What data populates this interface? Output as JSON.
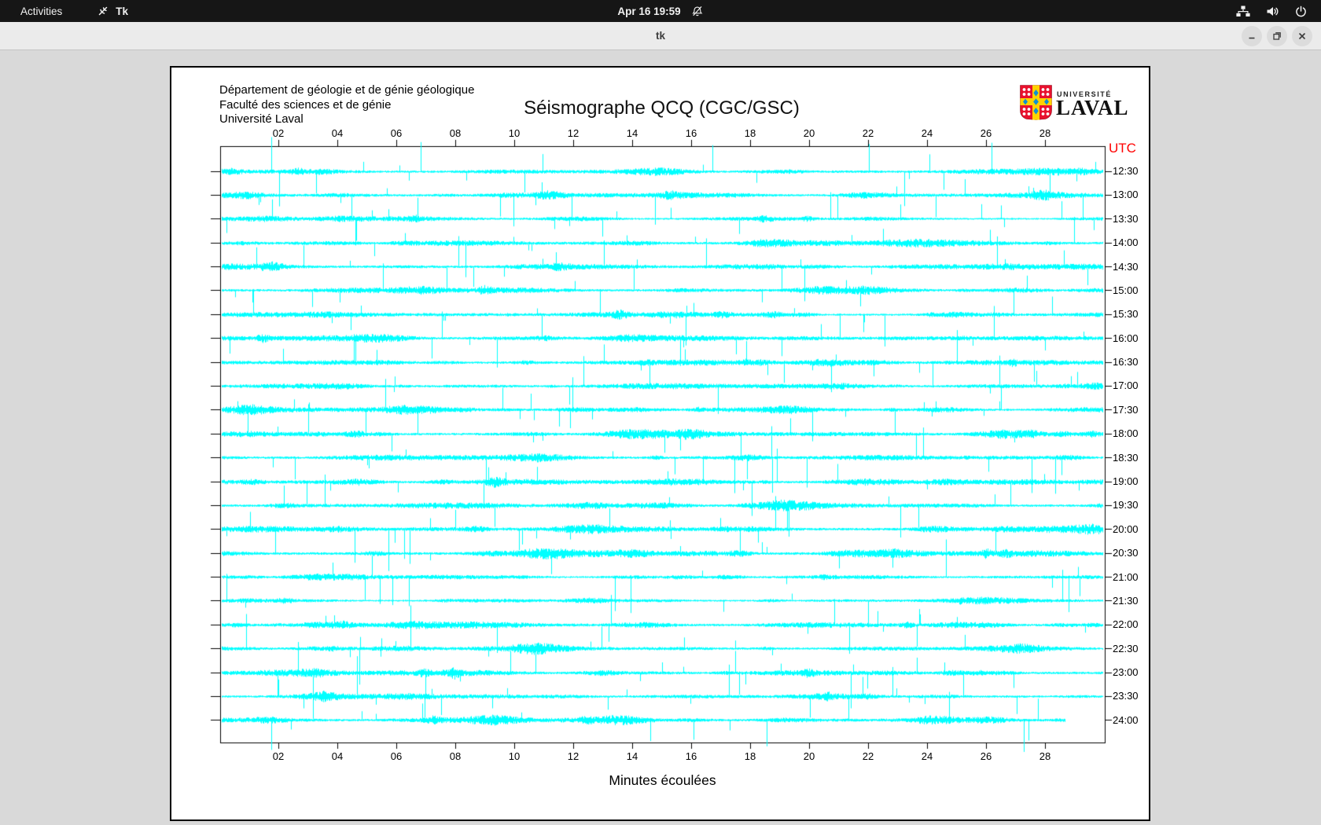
{
  "topbar": {
    "activities": "Activities",
    "app_name": "Tk",
    "clock": "Apr 16 19:59",
    "icons": [
      "tk-app-icon",
      "notifications-muted-icon",
      "network-wired-icon",
      "volume-icon",
      "power-icon"
    ]
  },
  "window": {
    "title": "tk",
    "buttons": [
      "minimize",
      "maximize",
      "close"
    ]
  },
  "figure": {
    "header_lines": [
      "Département de géologie et de génie géologique",
      "Faculté des sciences et de génie",
      "Université Laval"
    ],
    "title": "Séismographe QCQ (CGC/GSC)",
    "utc_label": "UTC",
    "xlabel": "Minutes écoulées",
    "logo": {
      "small_text": "UNIVERSITÉ",
      "large_text": "LAVAL"
    }
  },
  "axis": {
    "minute_ticks": [
      "02",
      "04",
      "06",
      "08",
      "10",
      "12",
      "14",
      "16",
      "18",
      "20",
      "22",
      "24",
      "26",
      "28"
    ],
    "time_labels": [
      "12:30",
      "13:00",
      "13:30",
      "14:00",
      "14:30",
      "15:00",
      "15:30",
      "16:00",
      "16:30",
      "17:00",
      "17:30",
      "18:00",
      "18:30",
      "19:00",
      "19:30",
      "20:00",
      "20:30",
      "21:00",
      "21:30",
      "22:00",
      "22:30",
      "23:00",
      "23:30",
      "24:00"
    ]
  },
  "traces": {
    "count": 24,
    "minutes_per_line": 30,
    "last_trace_end_fraction": 0.955
  },
  "colors": {
    "trace_cyan": "#00ffff",
    "utc_red": "#ff0000",
    "frame_black": "#000000",
    "crest_red": "#e8112d",
    "crest_yellow": "#ffd200",
    "crest_blue": "#0f8fd4"
  }
}
